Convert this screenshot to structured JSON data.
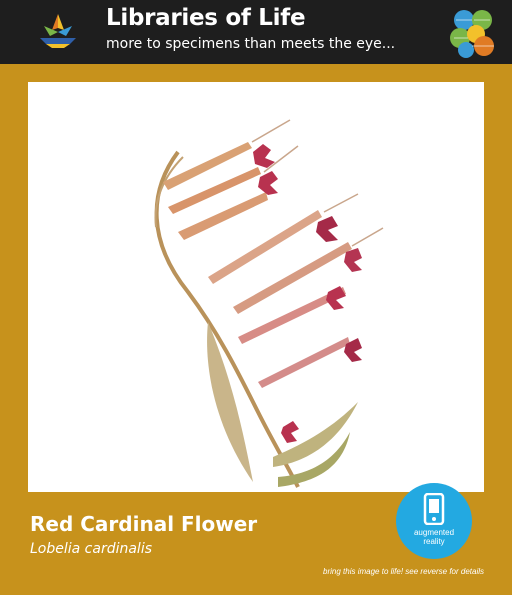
{
  "header": {
    "title": "Libraries of Life",
    "tagline": "more to specimens than meets the eye..."
  },
  "specimen": {
    "common_name": "Red Cardinal Flower",
    "scientific_name": "Lobelia cardinalis"
  },
  "ar_badge": {
    "label": "augmented\nreality",
    "icon": "phone-icon"
  },
  "footer": {
    "note": "bring this image to life! see reverse for details"
  },
  "colors": {
    "header_bg": "#1e1e1e",
    "frame": "#c7921c",
    "ar_badge": "#23a9e1",
    "petal": "#b8324f",
    "stem": "#b9925a"
  }
}
